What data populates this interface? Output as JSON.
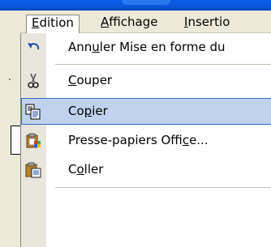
{
  "menubar": {
    "items": [
      {
        "pre": "",
        "u": "E",
        "post": "dition"
      },
      {
        "pre": "",
        "u": "A",
        "post": "ffichage"
      },
      {
        "pre": "",
        "u": "I",
        "post": "nsertio"
      }
    ]
  },
  "menu": {
    "items": [
      {
        "icon": "undo-icon",
        "pre": "Ann",
        "u": "u",
        "post": "ler Mise en forme du"
      },
      {
        "icon": "scissors-icon",
        "pre": "",
        "u": "C",
        "post": "ouper"
      },
      {
        "icon": "copy-icon",
        "pre": "Co",
        "u": "p",
        "post": "ier"
      },
      {
        "icon": "clipboard-office-icon",
        "pre": "Presse-papiers Offi",
        "u": "c",
        "post": "e..."
      },
      {
        "icon": "paste-icon",
        "pre": "C",
        "u": "o",
        "post": "ller"
      }
    ]
  },
  "colors": {
    "highlight_bg": "#c1d2ee",
    "highlight_border": "#316ac5",
    "menu_bg": "#ece9d8",
    "titlebar": "#0b56dc"
  }
}
